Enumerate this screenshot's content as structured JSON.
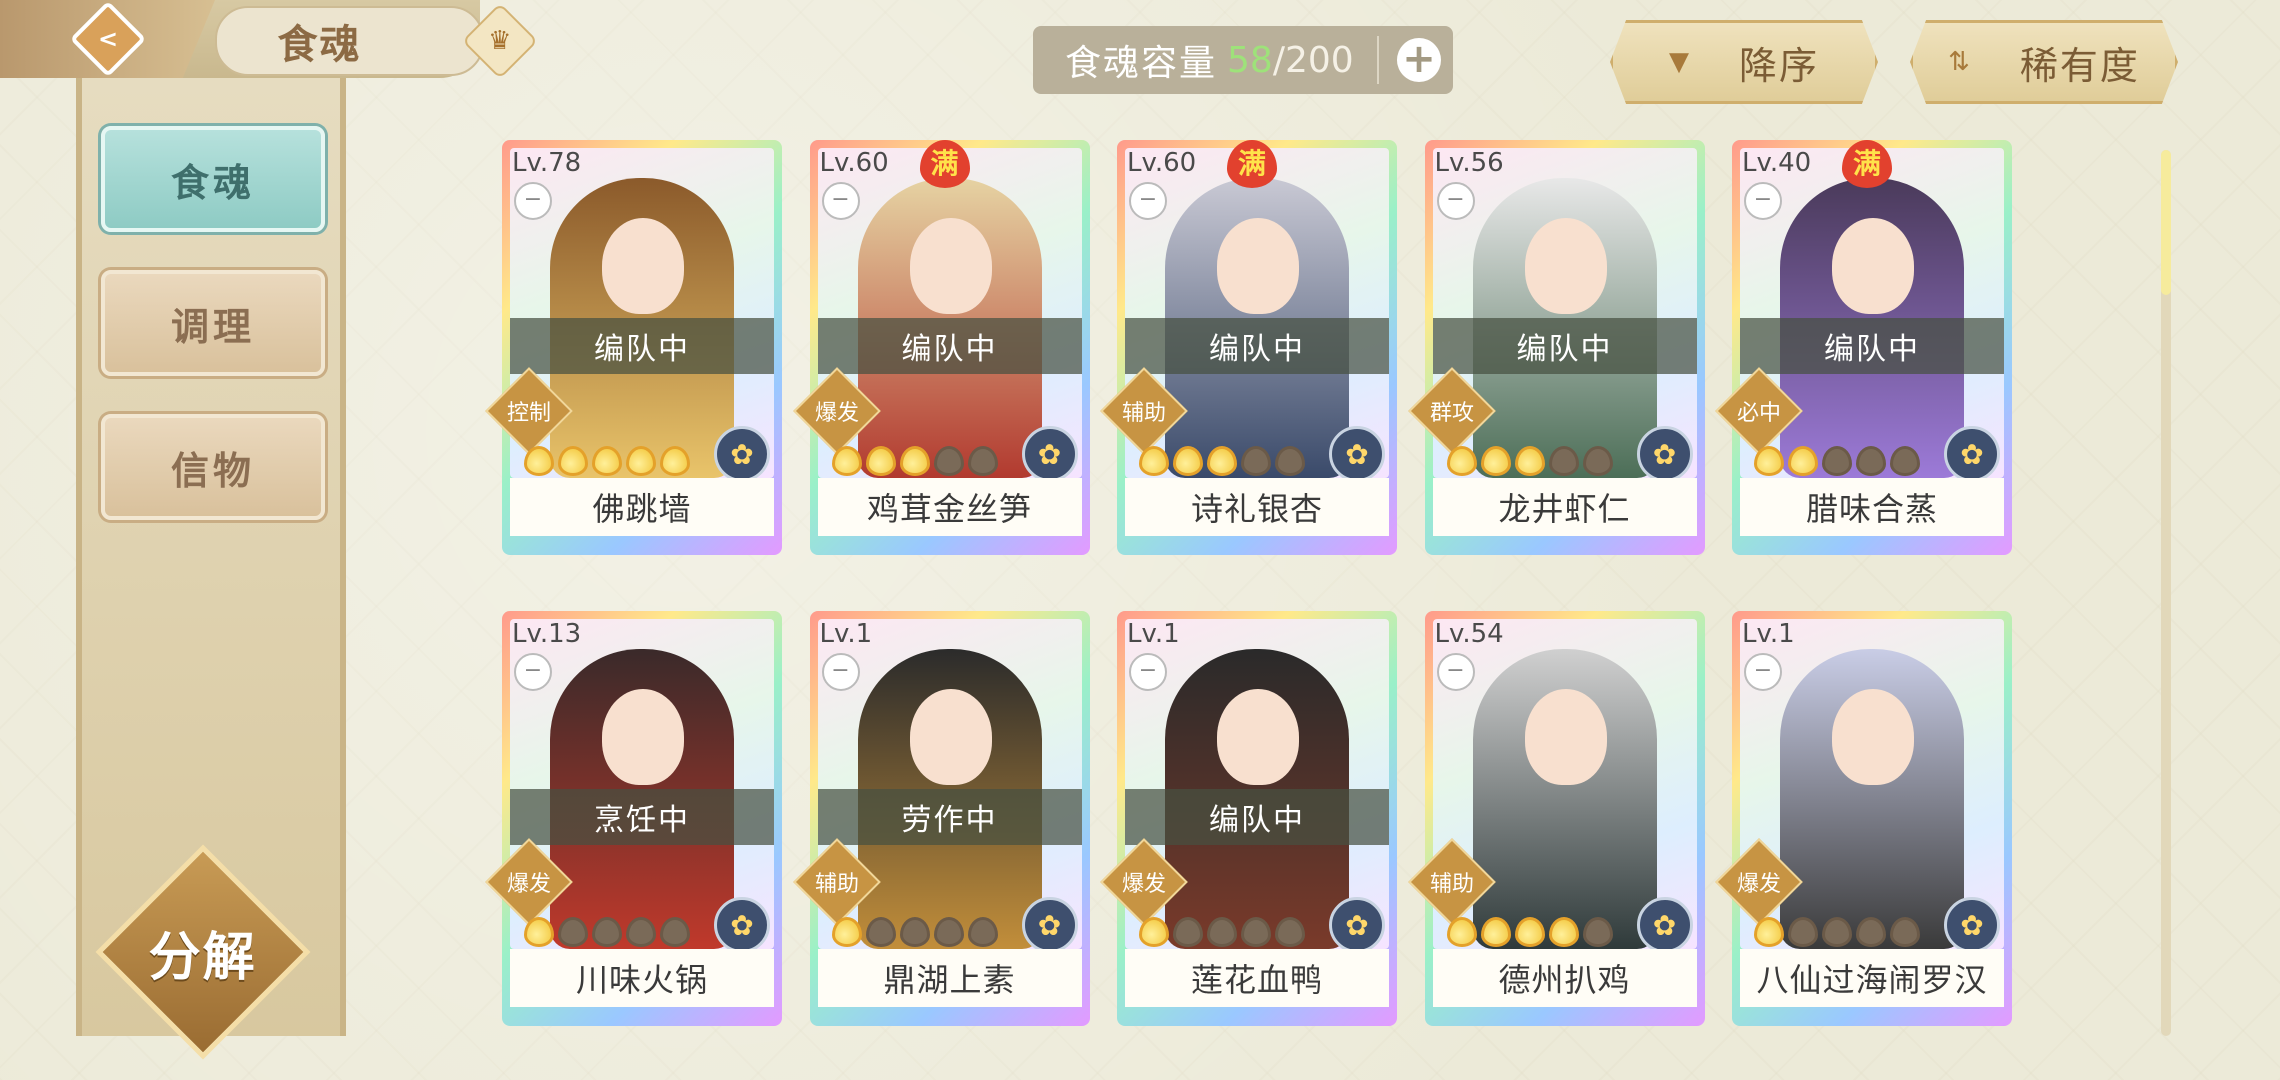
{
  "header": {
    "back_icon": "chevron-left-icon",
    "title": "食魂",
    "crown_icon": "crown-icon"
  },
  "capacity": {
    "label": "食魂容量",
    "current": "58",
    "max": "/200",
    "add_icon": "plus-icon",
    "current_color": "#9ee27a"
  },
  "sort": {
    "order_label": "降序",
    "rarity_label": "稀有度"
  },
  "sidebar": {
    "items": [
      {
        "label": "食魂",
        "active": true
      },
      {
        "label": "调理",
        "active": false
      },
      {
        "label": "信物",
        "active": false
      }
    ],
    "decompose_label": "分解"
  },
  "cards": [
    {
      "level": "Lv.78",
      "full": "",
      "status": "编队中",
      "type": "控制",
      "stars": 5,
      "name": "佛跳墙"
    },
    {
      "level": "Lv.60",
      "full": "满",
      "status": "编队中",
      "type": "爆发",
      "stars": 3,
      "name": "鸡茸金丝笋"
    },
    {
      "level": "Lv.60",
      "full": "满",
      "status": "编队中",
      "type": "辅助",
      "stars": 3,
      "name": "诗礼银杏"
    },
    {
      "level": "Lv.56",
      "full": "",
      "status": "编队中",
      "type": "群攻",
      "stars": 3,
      "name": "龙井虾仁"
    },
    {
      "level": "Lv.40",
      "full": "满",
      "status": "编队中",
      "type": "必中",
      "stars": 2,
      "name": "腊味合蒸"
    },
    {
      "level": "Lv.13",
      "full": "",
      "status": "烹饪中",
      "type": "爆发",
      "stars": 1,
      "name": "川味火锅"
    },
    {
      "level": "Lv.1",
      "full": "",
      "status": "劳作中",
      "type": "辅助",
      "stars": 1,
      "name": "鼎湖上素"
    },
    {
      "level": "Lv.1",
      "full": "",
      "status": "编队中",
      "type": "爆发",
      "stars": 1,
      "name": "莲花血鸭"
    },
    {
      "level": "Lv.54",
      "full": "",
      "status": "",
      "type": "辅助",
      "stars": 4,
      "name": "德州扒鸡"
    },
    {
      "level": "Lv.1",
      "full": "",
      "status": "",
      "type": "爆发",
      "stars": 1,
      "name": "八仙过海闹罗汉"
    }
  ],
  "scroll": {
    "position": 0.0
  }
}
